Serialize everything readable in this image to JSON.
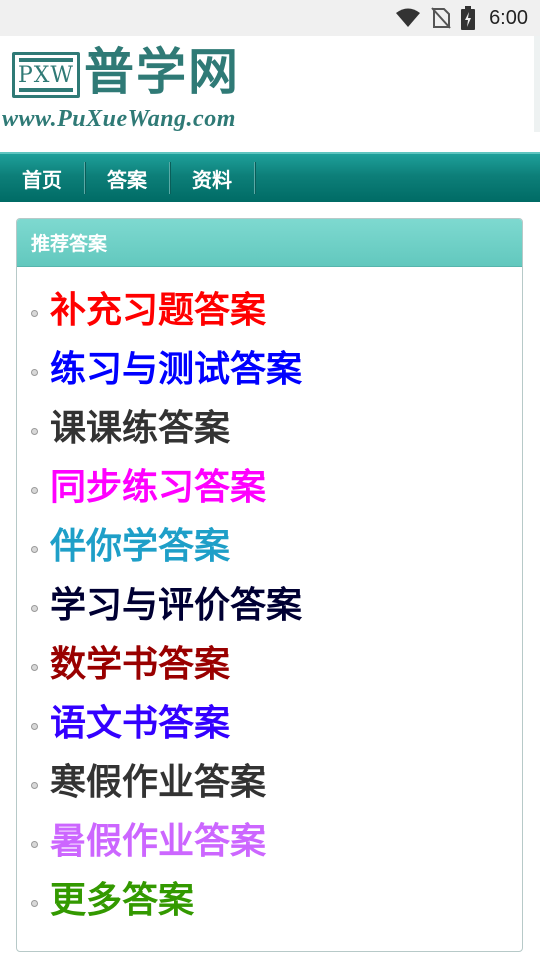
{
  "status_bar": {
    "time": "6:00",
    "icons": [
      "wifi-icon",
      "no-sim-icon",
      "battery-charging-icon"
    ]
  },
  "header": {
    "logo_abbr": "PXW",
    "logo_cn": "普学网",
    "logo_url": "www.PuXueWang.com"
  },
  "nav": {
    "items": [
      {
        "label": "首页"
      },
      {
        "label": "答案"
      },
      {
        "label": "资料"
      }
    ]
  },
  "panel": {
    "title": "推荐答案",
    "links": [
      {
        "label": "补充习题答案",
        "color": "#ff0000"
      },
      {
        "label": "练习与测试答案",
        "color": "#0000ff"
      },
      {
        "label": "课课练答案",
        "color": "#333333"
      },
      {
        "label": "同步练习答案",
        "color": "#ff00ff"
      },
      {
        "label": "伴你学答案",
        "color": "#1e9fc8"
      },
      {
        "label": "学习与评价答案",
        "color": "#000033"
      },
      {
        "label": "数学书答案",
        "color": "#990000"
      },
      {
        "label": "语文书答案",
        "color": "#3300ff"
      },
      {
        "label": "寒假作业答案",
        "color": "#333333"
      },
      {
        "label": "暑假作业答案",
        "color": "#cc66ff"
      },
      {
        "label": "更多答案",
        "color": "#339900"
      }
    ]
  }
}
